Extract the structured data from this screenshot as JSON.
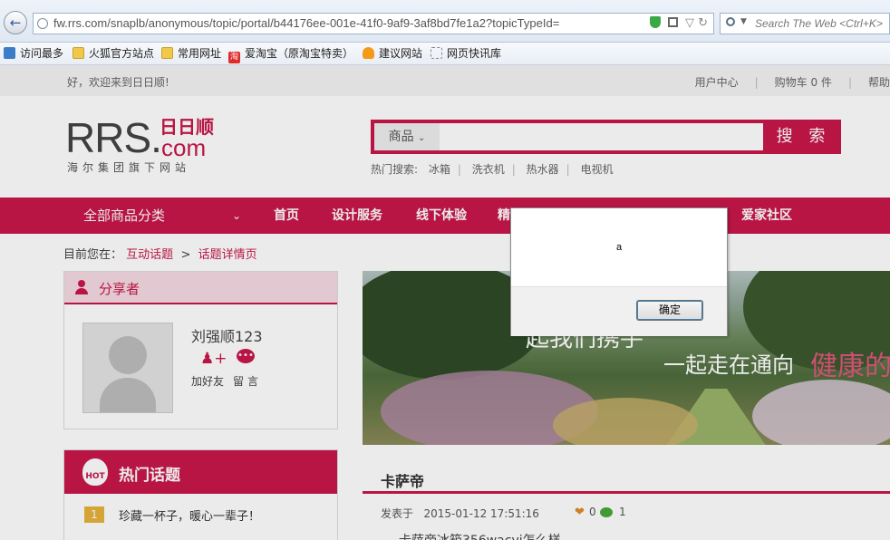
{
  "browser": {
    "url": "fw.rrs.com/snaplb/anonymous/topic/portal/b44176ee-001e-41f0-9af9-3af8bd7fe1a2?topicTypeId=",
    "search_placeholder": "Search The Web <Ctrl+K>",
    "bookmarks": [
      "访问最多",
      "火狐官方站点",
      "常用网址",
      "爱淘宝（原淘宝特卖）",
      "建议网站",
      "网页快讯库"
    ]
  },
  "site": {
    "welcome": "好，欢迎来到日日顺!",
    "top_nav": [
      "用户中心",
      "购物车 0 件",
      "帮助"
    ],
    "logo": {
      "main": "RRS.",
      "cn": "日日顺",
      "com": "com",
      "sub": "海尔集团旗下网站"
    },
    "search": {
      "category": "商品",
      "button": "搜 索",
      "hot_label": "热门搜索:",
      "hot_terms": [
        "冰箱",
        "洗衣机",
        "热水器",
        "电视机"
      ]
    },
    "nav": {
      "all": "全部商品分类",
      "items": [
        "首页",
        "设计服务",
        "线下体验",
        "精",
        "爱家社区"
      ]
    },
    "breadcrumb": {
      "label": "目前您在：",
      "level1": "互动话题",
      "sep": ">",
      "level2": "话题详情页"
    },
    "share": {
      "title": "分享者",
      "username": "刘强顺123",
      "add_friend": "加好友",
      "message": "留言"
    },
    "hot": {
      "title": "热门话题",
      "items": [
        {
          "rank": "1",
          "title": "珍藏一杯子，暖心一辈子！"
        }
      ]
    },
    "banner": {
      "text1": "起我们携手",
      "text2": "一起走在通向",
      "text3": "健康的"
    },
    "topic": {
      "title": "卡萨帝",
      "posted_label": "发表于",
      "date": "2015-01-12 17:51:16",
      "likes": "0",
      "comments": "1",
      "body": "卡萨帝冰箱356wacvj怎么样"
    }
  },
  "dialog": {
    "message": "a",
    "ok": "确定"
  }
}
